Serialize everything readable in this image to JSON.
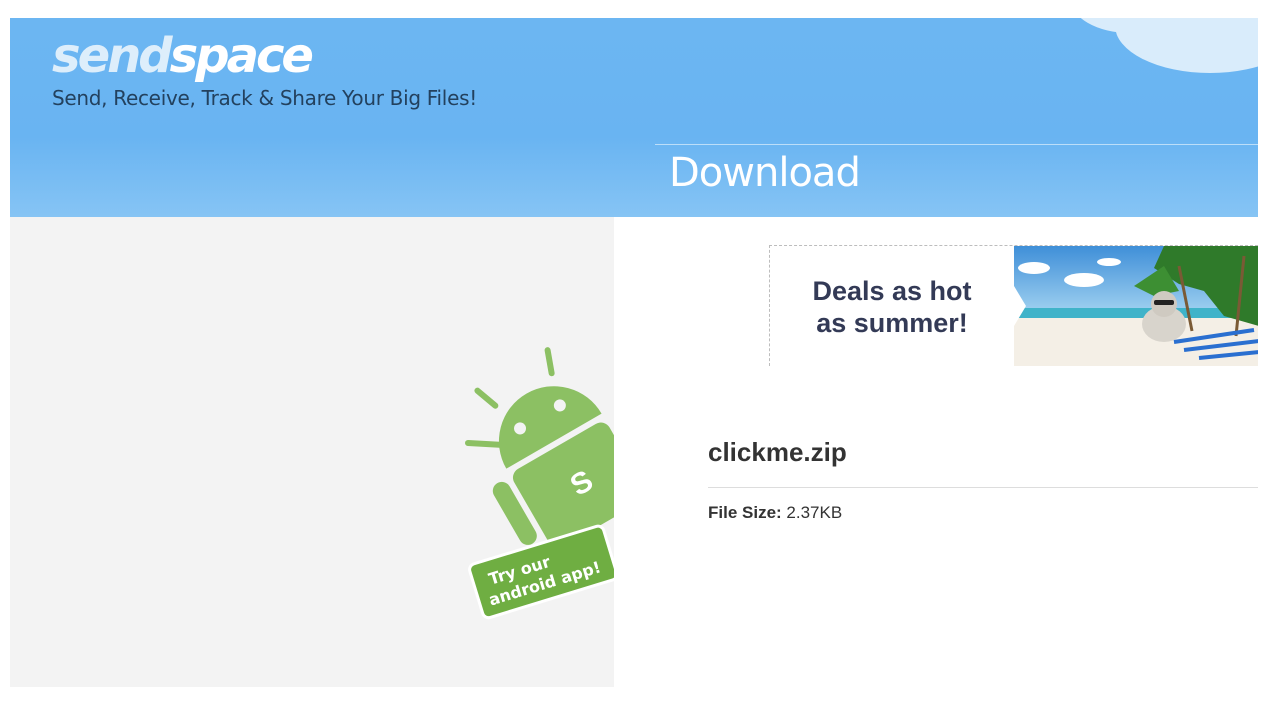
{
  "header": {
    "logo_part1": "send",
    "logo_part2": "space",
    "tagline": "Send, Receive, Track & Share Your Big Files!",
    "page_title": "Download"
  },
  "promo": {
    "android_label_line1": "Try our",
    "android_label_line2": "android app!"
  },
  "ad": {
    "line1": "Deals as hot",
    "line2": "as summer!"
  },
  "file": {
    "name": "clickme.zip",
    "size_label": "File Size:",
    "size_value": "2.37KB"
  },
  "colors": {
    "header_blue": "#6cb6f2",
    "android_green": "#8cc063",
    "label_green": "#6fae42",
    "text_dark": "#333333"
  },
  "icons": [
    "android-robot-icon",
    "cloud-icon",
    "beach-image"
  ]
}
